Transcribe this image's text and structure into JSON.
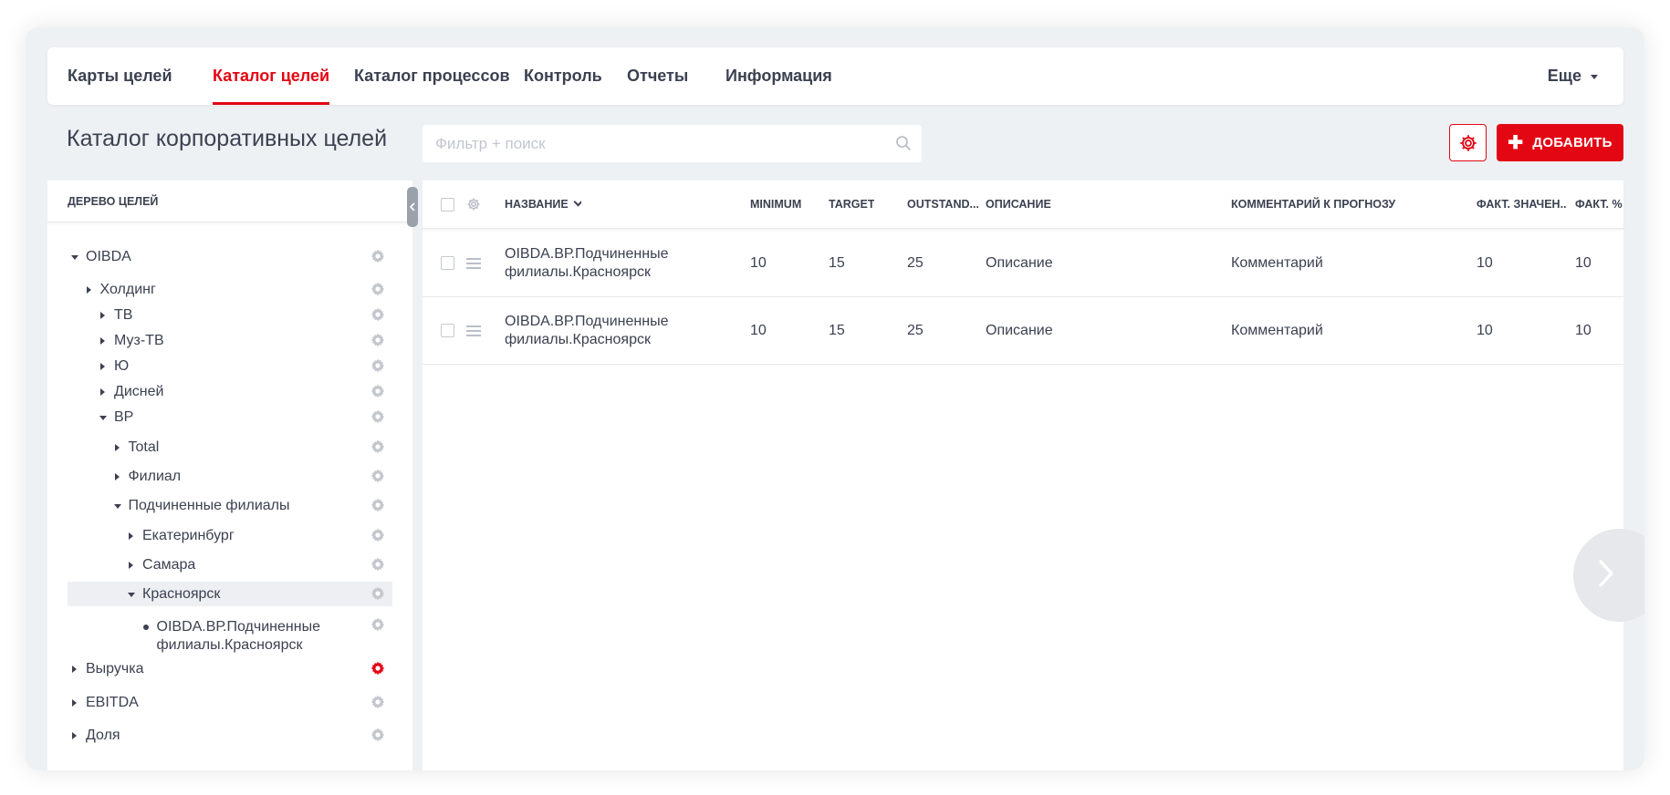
{
  "nav": {
    "tabs": [
      {
        "label": "Карты целей",
        "active": false
      },
      {
        "label": "Каталог целей",
        "active": true
      },
      {
        "label": "Каталог процессов",
        "active": false
      },
      {
        "label": "Контроль",
        "active": false
      },
      {
        "label": "Отчеты",
        "active": false
      },
      {
        "label": "Информация",
        "active": false
      }
    ],
    "more_label": "Еще"
  },
  "page": {
    "title": "Каталог корпоративных целей",
    "search_placeholder": "Фильтр + поиск",
    "add_label": "ДОБАВИТЬ"
  },
  "tree": {
    "header": "ДЕРЕВО ЦЕЛЕЙ",
    "items": [
      {
        "label": "OIBDA",
        "state": "expanded",
        "level": 0
      },
      {
        "label": "Холдинг",
        "state": "collapsed",
        "level": 1
      },
      {
        "label": "ТВ",
        "state": "collapsed",
        "level": 2
      },
      {
        "label": "Муз-ТВ",
        "state": "collapsed",
        "level": 2
      },
      {
        "label": "Ю",
        "state": "collapsed",
        "level": 2
      },
      {
        "label": "Дисней",
        "state": "collapsed",
        "level": 2
      },
      {
        "label": "ВР",
        "state": "expanded",
        "level": 2
      },
      {
        "label": "Total",
        "state": "collapsed",
        "level": 3
      },
      {
        "label": "Филиал",
        "state": "collapsed",
        "level": 3
      },
      {
        "label": "Подчиненные филиалы",
        "state": "expanded",
        "level": 3
      },
      {
        "label": "Екатеринбург",
        "state": "collapsed",
        "level": 4
      },
      {
        "label": "Самара",
        "state": "collapsed",
        "level": 4
      },
      {
        "label": "Красноярск",
        "state": "expanded",
        "level": 4,
        "selected": true
      },
      {
        "label_line1": "OIBDA.ВР.Подчиненные",
        "label_line2": "филиалы.Красноярск",
        "state": "leaf",
        "level": 5
      },
      {
        "label": "Выручка",
        "state": "collapsed",
        "level": 0,
        "gear_active": true
      },
      {
        "label": "EBITDA",
        "state": "collapsed",
        "level": 0
      },
      {
        "label": "Доля",
        "state": "collapsed",
        "level": 0
      }
    ]
  },
  "table": {
    "columns": {
      "name": "НАЗВАНИЕ",
      "minimum": "MINIMUM",
      "target": "TARGET",
      "outstanding": "OUTSTAND...",
      "description": "ОПИСАНИЕ",
      "comment": "КОММЕНТАРИЙ К ПРОГНОЗУ",
      "fact_value": "ФАКТ. ЗНАЧЕН...",
      "fact_pct": "ФАКТ. %"
    },
    "rows": [
      {
        "name_line1": "OIBDA.ВР.Подчиненные",
        "name_line2": "филиалы.Красноярск",
        "minimum": "10",
        "target": "15",
        "outstanding": "25",
        "description": "Описание",
        "comment": "Комментарий",
        "fact_value": "10",
        "fact_pct": "10"
      },
      {
        "name_line1": "OIBDA.ВР.Подчиненные",
        "name_line2": "филиалы.Красноярск",
        "minimum": "10",
        "target": "15",
        "outstanding": "25",
        "description": "Описание",
        "comment": "Комментарий",
        "fact_value": "10",
        "fact_pct": "10"
      }
    ]
  },
  "colors": {
    "accent": "#e30613",
    "text": "#3b4150",
    "background": "#eef1f4"
  },
  "icons": [
    "gear-icon",
    "search-icon",
    "plus-icon",
    "chevron-left-icon",
    "chevron-right-icon",
    "drag-handle-icon",
    "sort-down-icon"
  ]
}
